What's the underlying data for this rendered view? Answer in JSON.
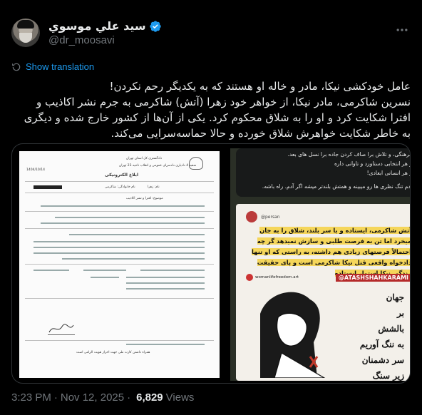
{
  "author": {
    "display_name": "سيد علي موسوي",
    "handle": "@dr_moosavi",
    "verified": true
  },
  "translate_label": "Show translation",
  "tweet_text": [
    "عامل خودکشی نیکا، مادر و خاله او هستند که به یکدیگر رحم نکردن!",
    "نسرین شاکرمی، مادر نیکا، از خواهر خود زهرا (آتش) شاکرمی به جرم نشر اکاذیب و",
    "افترا شکایت کرد و او را به شلاق محکوم کرد. یکی از آن‌ها از کشور خارج شده و دیگری",
    "به خاطر شکایت خواهرش شلاق خورده و حالا حماسه‌سرایی می‌کند."
  ],
  "media": {
    "document": {
      "title": "ابلاغ الکترونیکی",
      "header_org": "دادگستری کل استان تهران",
      "branch": "شعبه 4 دادیاری دادسرای عمومی و انقلاب ناحیه 23 تهران",
      "name_label": "نام: زهرا",
      "family_label": "نام خانوادگی: شاکرمی",
      "father_label": "نام پدر",
      "subject_label": "موضوع: افترا و نشر اکاذیب",
      "date": "1404/10/14",
      "footer_note": "همراه داشتن کارت ملی جهت احراز هویت الزامی است"
    },
    "story": {
      "top_lines": [
        "فرهنگی، و تلاش برا صاف کردن جاده برا نسل های بعد.",
        "و هر انتخابی دستاورد و تاوانی داره",
        "و هر انسانی ابعادی!",
        "آدم تنگ نظری ها رو میبینه و همتش بلندتر میشه اگر آدم. راه باشه."
      ],
      "username": "@persan",
      "quote": "آتش شاکرمی، ایستاده و با سر بلند، شلاق را به جان میخرد اما تن به فرصت طلبی و سازش نمیدهد گر چه احتمالاً فرصتهای زیادی هم داشته، به راستی که او تنها دادخواه واقعی قتل نیکا شاکرمی است و پای حقیقت زندگی نیکا استوار ایستاده",
      "tag_account": "womanlifefreedom.art",
      "tag_hashtag": "@ATASHSHAHKARAMI",
      "art_lines": [
        "جهان",
        "بر",
        "بالشش",
        "به ننگ آوریم",
        "سر دشمنان",
        "زیر سنگ"
      ]
    }
  },
  "footer": {
    "time": "3:23 PM",
    "separator": "·",
    "date": "Nov 12, 2025",
    "views_count": "6,829",
    "views_label": "Views"
  },
  "colors": {
    "background": "#000000",
    "text": "#e7e9ea",
    "muted": "#71767b",
    "link": "#1d9bf0",
    "verified": "#1d9bf0"
  }
}
